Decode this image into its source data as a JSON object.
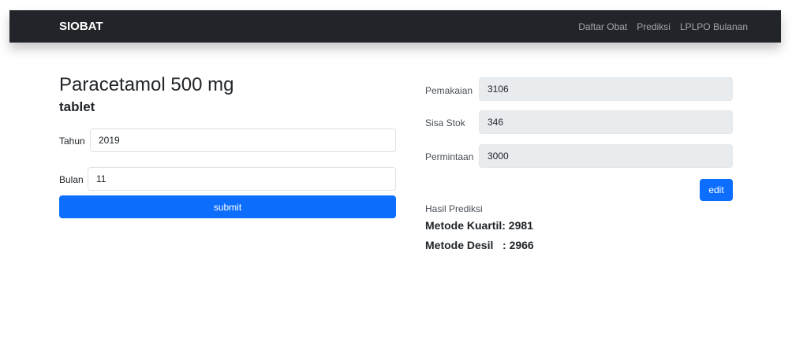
{
  "navbar": {
    "brand": "SIOBAT",
    "links": [
      "Daftar Obat",
      "Prediksi",
      "LPLPO Bulanan"
    ]
  },
  "drug": {
    "name": "Paracetamol 500 mg",
    "unit": "tablet"
  },
  "form": {
    "year_label": "Tahun",
    "year_value": "2019",
    "month_label": "Bulan",
    "month_value": "11",
    "submit_label": "submit"
  },
  "details": {
    "usage_label": "Pemakaian",
    "usage_value": "3106",
    "stock_label": "Sisa Stok",
    "stock_value": "346",
    "request_label": "Permintaan",
    "request_value": "3000",
    "edit_label": "edit"
  },
  "prediction": {
    "title": "Hasil Prediksi",
    "quartile": "Metode Kuartil: 2981",
    "decile": "Metode Desil   : 2966"
  },
  "colors": {
    "navbar_bg": "#212529",
    "primary": "#0d6efd",
    "readonly_bg": "#e9ecef"
  }
}
